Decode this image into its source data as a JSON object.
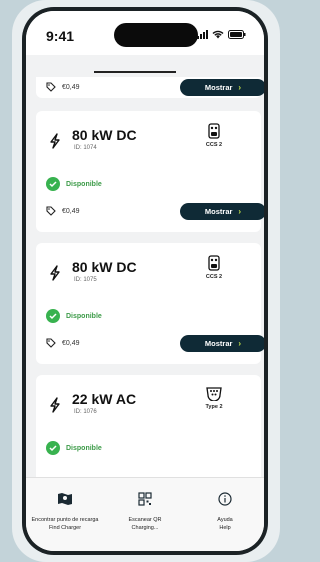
{
  "status_bar": {
    "time": "9:41"
  },
  "cards": [
    {
      "partial": true,
      "price": "€0,49",
      "button_label": "Mostrar"
    },
    {
      "title": "80 kW DC",
      "id_label": "ID: 1074",
      "connector": "CCS 2",
      "connector_icon": "ccs2-connector-icon",
      "status": "Disponible",
      "price": "€0,49",
      "button_label": "Mostrar"
    },
    {
      "title": "80 kW DC",
      "id_label": "ID: 1075",
      "connector": "CCS 2",
      "connector_icon": "ccs2-connector-icon",
      "status": "Disponible",
      "price": "€0,49",
      "button_label": "Mostrar"
    },
    {
      "title": "22 kW AC",
      "id_label": "ID: 1076",
      "connector": "Type 2",
      "connector_icon": "type2-connector-icon",
      "status": "Disponible"
    }
  ],
  "tabs": [
    {
      "label": "Encontrar punto de recarga",
      "sublabel": "Find Charger",
      "icon": "map-icon"
    },
    {
      "label": "Escanear QR",
      "sublabel": "Charging...",
      "icon": "qr-code-icon"
    },
    {
      "label": "Ayuda",
      "sublabel": "Help",
      "icon": "info-icon"
    }
  ],
  "colors": {
    "accent_dark": "#0f2a36",
    "available_green": "#38b24f",
    "chevron_lime": "#c8e64a"
  }
}
